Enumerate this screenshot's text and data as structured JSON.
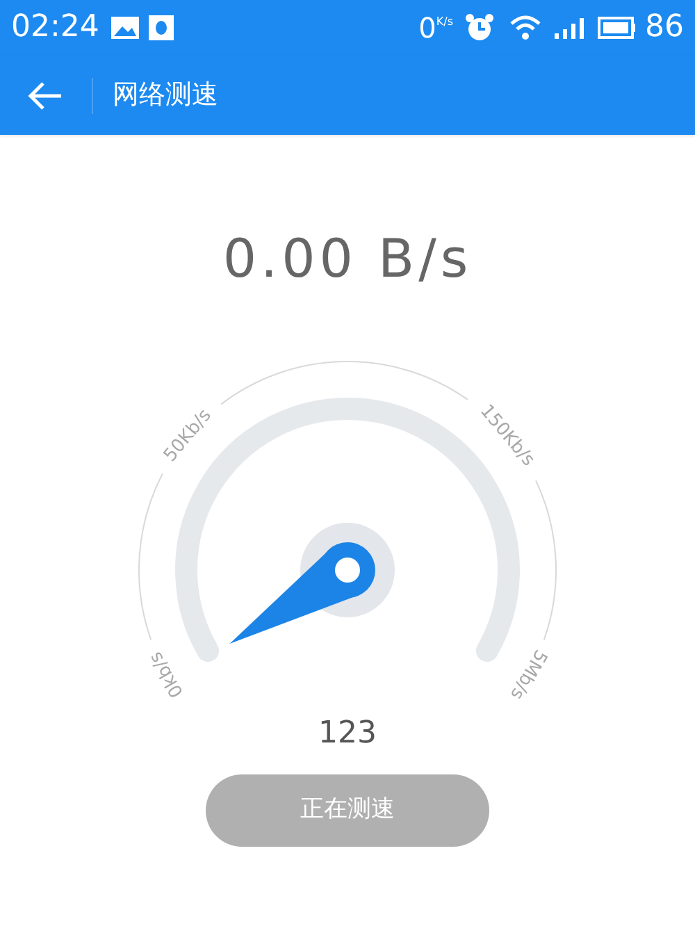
{
  "status_bar": {
    "time": "02:24",
    "net_speed": "0",
    "net_unit": "K/s",
    "battery": "86"
  },
  "toolbar": {
    "title": "网络测速"
  },
  "speed": "0.00 B/s",
  "gauge": {
    "ticks": [
      {
        "label": "0kb/s"
      },
      {
        "label": "50Kb/s"
      },
      {
        "label": "150Kb/s"
      },
      {
        "label": "5Mb/s"
      }
    ]
  },
  "count": "123",
  "button": {
    "label": "正在测速",
    "disabled": true
  }
}
